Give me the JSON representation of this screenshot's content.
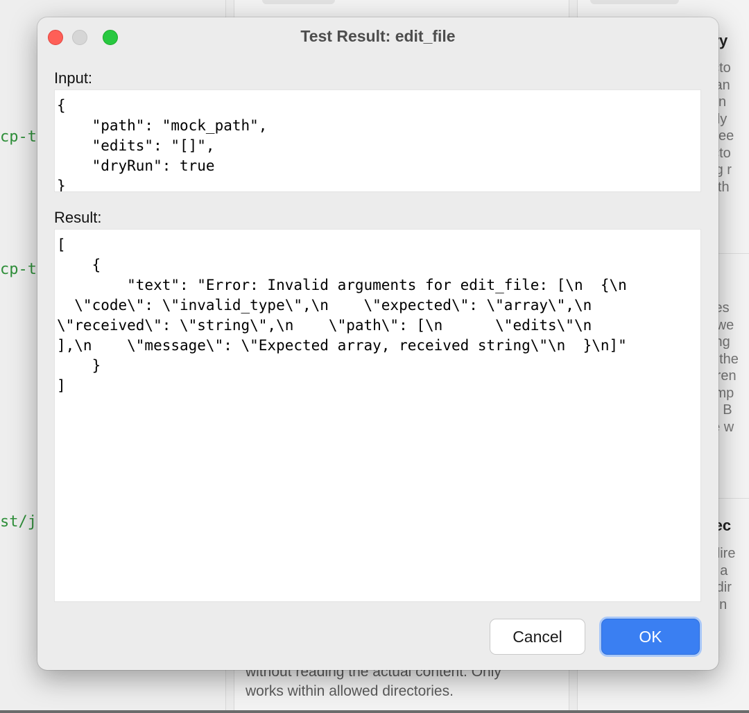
{
  "dialog": {
    "title": "Test Result: edit_file",
    "input_label": "Input:",
    "input_text": "{\n    \"path\": \"mock_path\",\n    \"edits\": \"[]\",\n    \"dryRun\": true\n}",
    "result_label": "Result:",
    "result_text": "[\n    {\n        \"text\": \"Error: Invalid arguments for edit_file: [\\n  {\\n\n  \\\"code\\\": \\\"invalid_type\\\",\\n    \\\"expected\\\": \\\"array\\\",\\n\n\\\"received\\\": \\\"string\\\",\\n    \\\"path\\\": [\\n      \\\"edits\\\"\\n\n],\\n    \\\"message\\\": \\\"Expected array, received string\\\"\\n  }\\n]\"\n    }\n]",
    "cancel_label": "Cancel",
    "ok_label": "OK"
  },
  "background": {
    "code_fragments": [
      "cp-to",
      "cp-to",
      "st/ja"
    ],
    "right_card_1": {
      "heading": "ory",
      "snippets": [
        "ecto",
        "Can",
        "s in",
        "ady",
        "ccee",
        "ecto",
        "ing r",
        "with"
      ]
    },
    "right_card_2": {
      "snippets": [
        "files",
        "etwe",
        "sing",
        "s, the",
        "feren",
        "simp",
        "ry. B",
        "be w"
      ]
    },
    "right_card_3": {
      "heading": "irec",
      "snippets": [
        "f dire",
        "to a",
        "n dir",
        "ryin"
      ]
    },
    "footer_text": [
      "without reading the actual content. Only",
      "works within allowed directories."
    ]
  },
  "colors": {
    "ok_button": "#3a7ff2",
    "close_button": "#fe5f57",
    "maximize_button": "#28c840",
    "code_fragment": "#2f8f3a"
  }
}
